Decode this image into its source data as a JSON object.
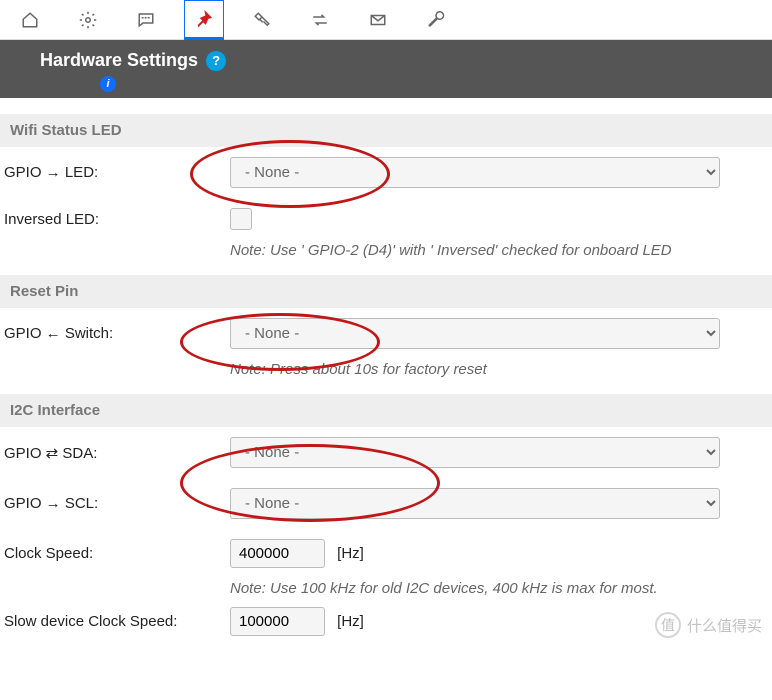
{
  "header": {
    "title": "Hardware Settings"
  },
  "wifi_led": {
    "section": "Wifi Status LED",
    "gpio_led_label": "GPIO → LED:",
    "gpio_led_value": "- None -",
    "inversed_label": "Inversed LED:",
    "note": "Note: Use ' GPIO-2 (D4)'  with ' Inversed'  checked for onboard LED"
  },
  "reset": {
    "section": "Reset Pin",
    "switch_label": "GPIO ← Switch:",
    "switch_value": "- None -",
    "note": "Note: Press about 10s for factory reset"
  },
  "i2c": {
    "section": "I2C Interface",
    "sda_label": "GPIO ⇄ SDA:",
    "sda_value": "- None -",
    "scl_label": "GPIO → SCL:",
    "scl_value": "- None -",
    "clock_label": "Clock Speed:",
    "clock_value": "400000",
    "clock_unit": "[Hz]",
    "clock_note": "Note: Use 100 kHz for old I2C devices, 400 kHz is max for most.",
    "slow_label": "Slow device Clock Speed:",
    "slow_value": "100000",
    "slow_unit": "[Hz]"
  },
  "watermark": {
    "badge": "值",
    "text": "什么值得买"
  }
}
